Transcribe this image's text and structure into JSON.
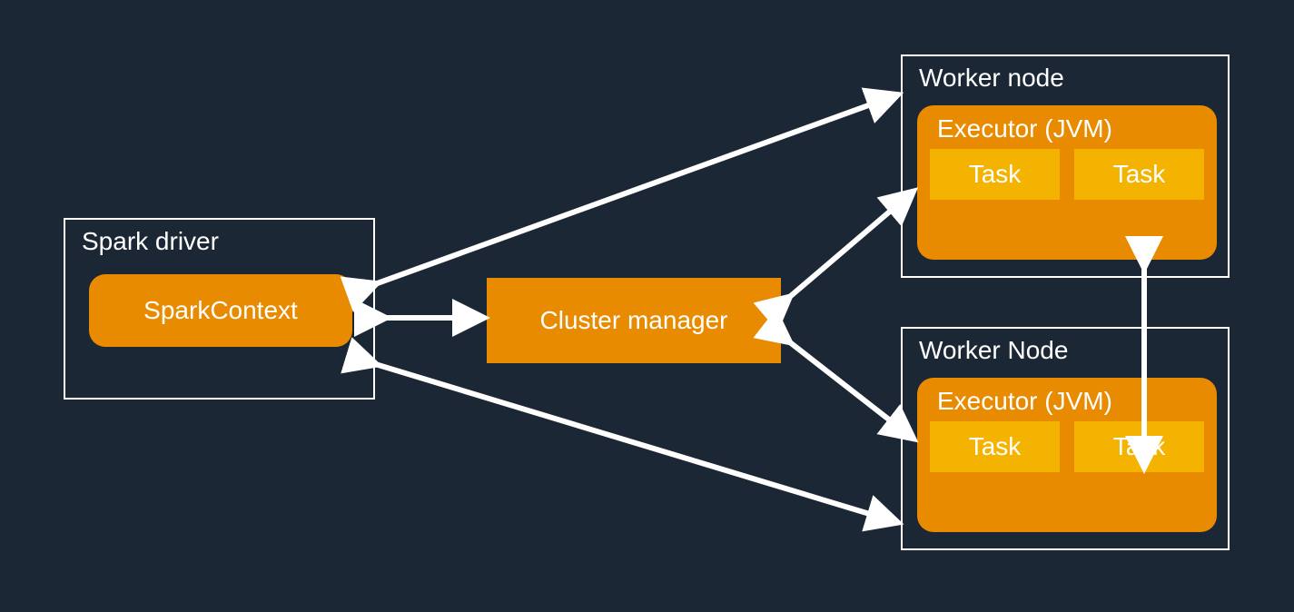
{
  "driver": {
    "title": "Spark driver",
    "context_label": "SparkContext"
  },
  "cluster_manager": {
    "label": "Cluster manager"
  },
  "workers": [
    {
      "title": "Worker node",
      "executor_label": "Executor (JVM)",
      "tasks": [
        "Task",
        "Task"
      ]
    },
    {
      "title": "Worker Node",
      "executor_label": "Executor (JVM)",
      "tasks": [
        "Task",
        "Task"
      ]
    }
  ],
  "colors": {
    "background": "#1b2735",
    "box_fill": "#e98b00",
    "task_fill": "#f5b301",
    "outline": "#ffffff"
  }
}
